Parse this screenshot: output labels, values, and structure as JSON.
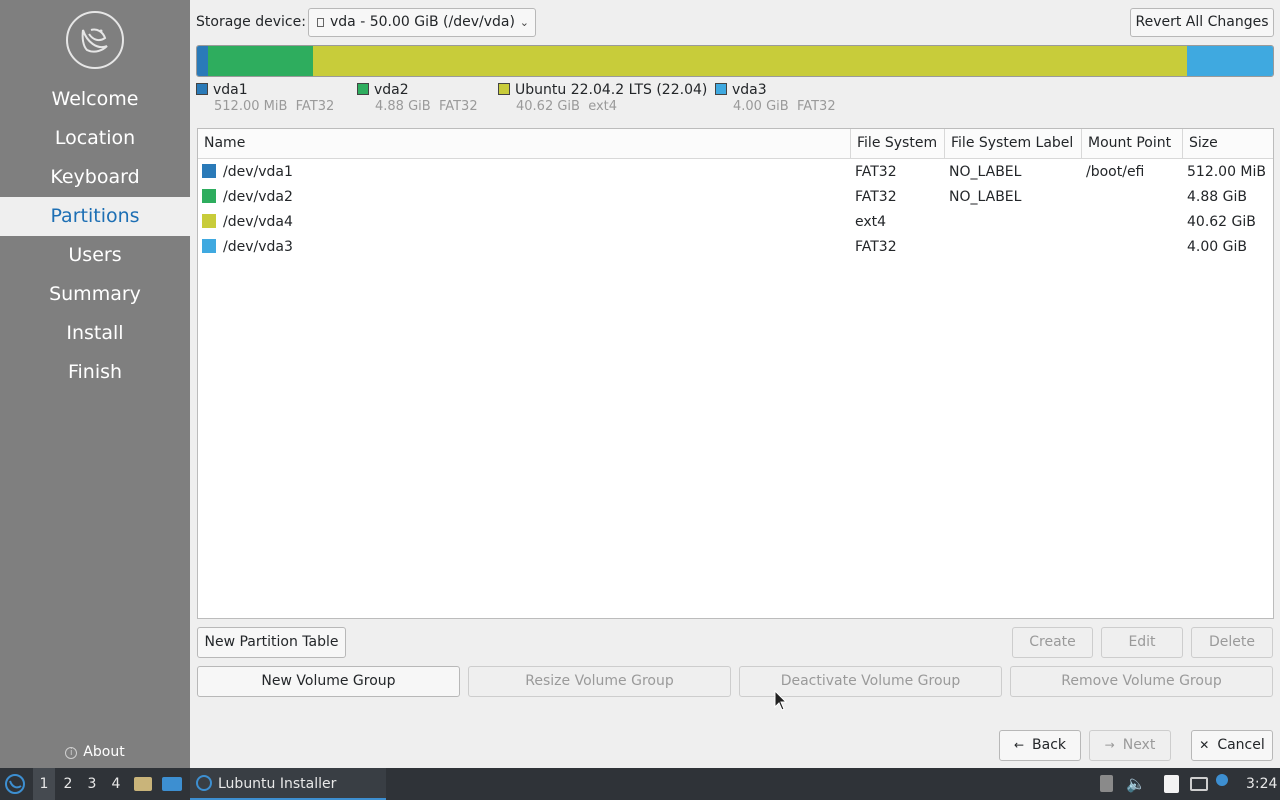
{
  "sidebar": {
    "items": [
      {
        "label": "Welcome",
        "active": false
      },
      {
        "label": "Location",
        "active": false
      },
      {
        "label": "Keyboard",
        "active": false
      },
      {
        "label": "Partitions",
        "active": true
      },
      {
        "label": "Users",
        "active": false
      },
      {
        "label": "Summary",
        "active": false
      },
      {
        "label": "Install",
        "active": false
      },
      {
        "label": "Finish",
        "active": false
      }
    ],
    "about_label": "About",
    "logo_icon": "lubuntu-bird-icon"
  },
  "storage": {
    "label": "Storage device:",
    "selected": "vda - 50.00 GiB (/dev/vda)",
    "revert_label": "Revert All Changes"
  },
  "partition_bar": [
    {
      "color": "#2a7ab8",
      "size_gib": 0.5
    },
    {
      "color": "#2ead5e",
      "size_gib": 4.88
    },
    {
      "color": "#c8cc3a",
      "size_gib": 40.62
    },
    {
      "color": "#3fa9e0",
      "size_gib": 4.0
    }
  ],
  "legend": [
    {
      "name": "vda1",
      "size": "512.00 MiB",
      "fs": "FAT32",
      "color": "#2a7ab8"
    },
    {
      "name": "vda2",
      "size": "4.88 GiB",
      "fs": "FAT32",
      "color": "#2ead5e"
    },
    {
      "name": "Ubuntu 22.04.2 LTS (22.04)",
      "size": "40.62 GiB",
      "fs": "ext4",
      "color": "#c8cc3a"
    },
    {
      "name": "vda3",
      "size": "4.00 GiB",
      "fs": "FAT32",
      "color": "#3fa9e0"
    }
  ],
  "table": {
    "columns": [
      "Name",
      "File System",
      "File System Label",
      "Mount Point",
      "Size"
    ],
    "rows": [
      {
        "name": "/dev/vda1",
        "fs": "FAT32",
        "label": "NO_LABEL",
        "mount": "/boot/efi",
        "size": "512.00 MiB",
        "color": "#2a7ab8"
      },
      {
        "name": "/dev/vda2",
        "fs": "FAT32",
        "label": "NO_LABEL",
        "mount": "",
        "size": "4.88 GiB",
        "color": "#2ead5e"
      },
      {
        "name": "/dev/vda4",
        "fs": "ext4",
        "label": "",
        "mount": "",
        "size": "40.62 GiB",
        "color": "#c8cc3a"
      },
      {
        "name": "/dev/vda3",
        "fs": "FAT32",
        "label": "",
        "mount": "",
        "size": "4.00 GiB",
        "color": "#3fa9e0"
      }
    ]
  },
  "actions": {
    "new_partition_table": "New Partition Table",
    "create": "Create",
    "edit": "Edit",
    "delete": "Delete",
    "new_volume_group": "New Volume Group",
    "resize_volume_group": "Resize Volume Group",
    "deactivate_volume_group": "Deactivate Volume Group",
    "remove_volume_group": "Remove Volume Group"
  },
  "nav": {
    "back": "Back",
    "next": "Next",
    "cancel": "Cancel"
  },
  "taskbar": {
    "desktops": [
      "1",
      "2",
      "3",
      "4"
    ],
    "active_desktop": "1",
    "task_label": "Lubuntu Installer",
    "clock": "3:24"
  }
}
